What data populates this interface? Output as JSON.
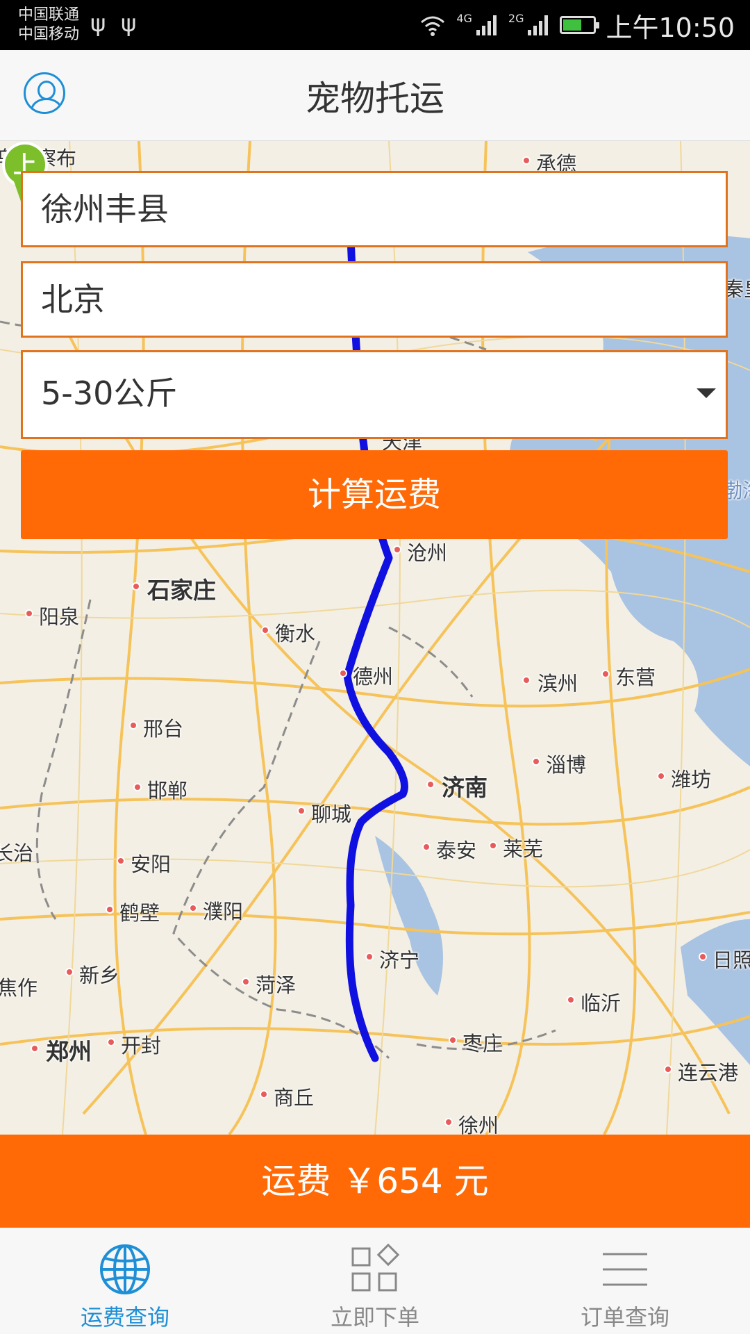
{
  "status_bar": {
    "carrier1": "中国联通",
    "carrier2": "中国移动",
    "network1": "4G",
    "network2": "2G",
    "time": "上午10:50"
  },
  "header": {
    "title": "宠物托运",
    "avatar_icon": "user-profile-icon"
  },
  "form": {
    "origin_value": "徐州丰县",
    "destination_value": "北京",
    "weight_selected": "5-30公斤",
    "calculate_label": "计算运费"
  },
  "map": {
    "start_marker_label": "上",
    "cities": {
      "wulanchabu": "乌兰察布",
      "chengde": "承德",
      "tianjin": "天津",
      "cangzhou": "沧州",
      "shijiazhuang": "石家庄",
      "yangquan": "阳泉",
      "hengshui": "衡水",
      "dezhou": "德州",
      "binzhou": "滨州",
      "dongying": "东营",
      "xingtai": "邢台",
      "zibo": "淄博",
      "jinan": "济南",
      "weifang": "潍坊",
      "handan": "邯郸",
      "liaocheng": "聊城",
      "changzhi": "长治",
      "taian": "泰安",
      "laiwu": "莱芜",
      "anyang": "安阳",
      "hebi": "鹤壁",
      "puyang": "濮阳",
      "jining": "济宁",
      "rizhao": "日照",
      "jiaozuo": "焦作",
      "xinxiang": "新乡",
      "heze": "菏泽",
      "linyi": "临沂",
      "zhengzhou": "郑州",
      "kaifeng": "开封",
      "zaozhuang": "枣庄",
      "lianyungang": "连云港",
      "shangqiu": "商丘",
      "xuzhou": "徐州",
      "qinhuangdao": "秦皇",
      "bohai": "渤海"
    }
  },
  "fee": {
    "text": "运费 ￥654 元"
  },
  "bottom_nav": {
    "items": [
      {
        "label": "运费查询",
        "icon": "globe-icon"
      },
      {
        "label": "立即下单",
        "icon": "grid-icon"
      },
      {
        "label": "订单查询",
        "icon": "menu-lines-icon"
      }
    ]
  },
  "colors": {
    "accent_orange": "#ff6a07",
    "field_border": "#e1731f",
    "active_blue": "#1e8fd6",
    "route_blue": "#1010e0"
  }
}
